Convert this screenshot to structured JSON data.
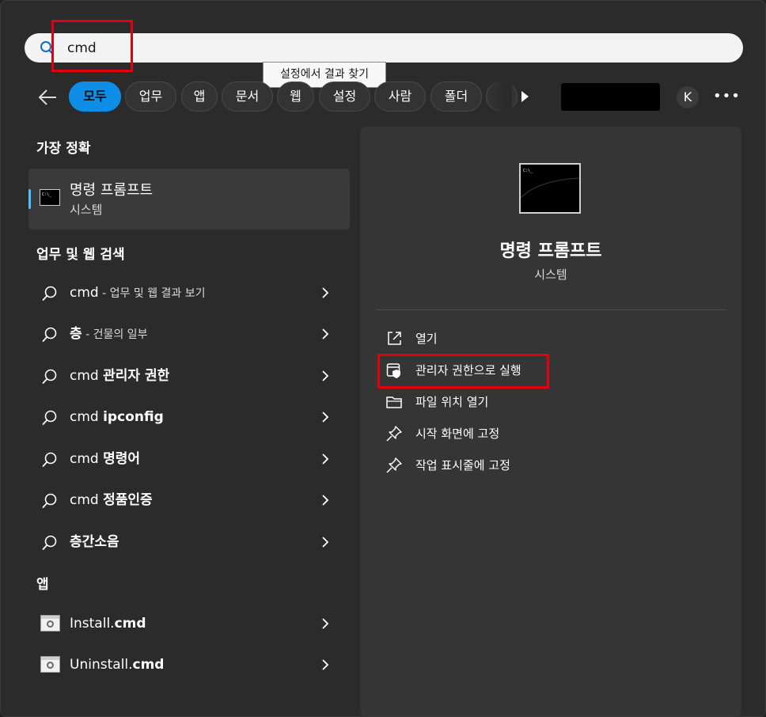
{
  "search": {
    "value": "cmd",
    "tooltip": "설정에서 결과 찾기"
  },
  "filters": [
    "모두",
    "업무",
    "앱",
    "문서",
    "웹",
    "설정",
    "사람",
    "폴더"
  ],
  "account": {
    "initial": "K"
  },
  "left": {
    "best_match_title": "가장 정확",
    "best_match": {
      "name": "명령 프롬프트",
      "type": "시스템"
    },
    "web_title": "업무 및 웹 검색",
    "web_results": [
      {
        "main": "cmd",
        "suffix": " - 업무 및 웹 결과 보기"
      },
      {
        "main": "층",
        "suffix": " - 건물의 일부"
      },
      {
        "pre": "cmd ",
        "main": "관리자 권한"
      },
      {
        "pre": "cmd ",
        "main": "ipconfig"
      },
      {
        "pre": "cmd ",
        "main": "명령어"
      },
      {
        "pre": "cmd ",
        "main": "정품인증"
      },
      {
        "main": "층간소음"
      }
    ],
    "apps_title": "앱",
    "apps": [
      {
        "pre": "Install.",
        "main": "cmd"
      },
      {
        "pre": "Uninstall.",
        "main": "cmd"
      }
    ]
  },
  "detail": {
    "title": "명령 프롬프트",
    "subtitle": "시스템",
    "actions": [
      {
        "label": "열기",
        "icon": "open-external-icon"
      },
      {
        "label": "관리자 권한으로 실행",
        "icon": "shield-window-icon"
      },
      {
        "label": "파일 위치 열기",
        "icon": "folder-icon"
      },
      {
        "label": "시작 화면에 고정",
        "icon": "pin-icon"
      },
      {
        "label": "작업 표시줄에 고정",
        "icon": "pin-icon"
      }
    ]
  },
  "colors": {
    "accent": "#0f8ee8",
    "highlight_box": "#e00010",
    "panel": "#353535",
    "background": "#2b2b2b"
  }
}
